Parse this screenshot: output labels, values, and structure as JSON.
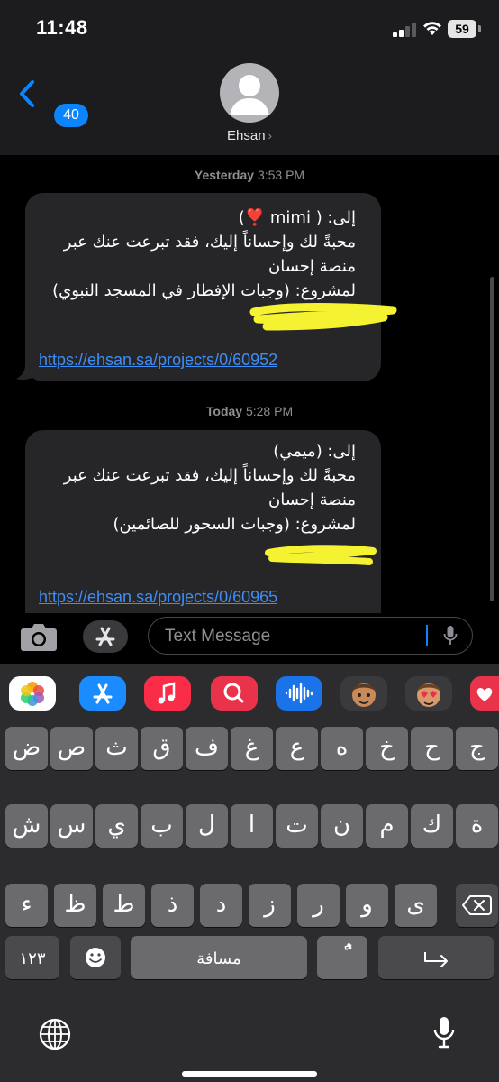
{
  "status_bar": {
    "time": "11:48",
    "battery": "59"
  },
  "header": {
    "unread_count": "40",
    "contact_name": "Ehsan",
    "contact_chevron": "›"
  },
  "messages": [
    {
      "timestamp_day": "Yesterday",
      "timestamp_time": "3:53 PM",
      "lines": [
        "إلى: ( mimi ❣️)",
        "محبةً لك وإحساناً إليك، فقد تبرعت عنك عبر",
        "منصة إحسان",
        "لمشروع: (وجبات الإفطار في المسجد النبوي)"
      ],
      "link": "https://ehsan.sa/projects/0/60952"
    },
    {
      "timestamp_day": "Today",
      "timestamp_time": "5:28 PM",
      "lines": [
        "إلى: (ميمي)",
        "محبةً لك وإحساناً إليك، فقد تبرعت عنك عبر",
        "منصة إحسان",
        "لمشروع: (وجبات السحور للصائمين)"
      ],
      "link": "https://ehsan.sa/projects/0/60965"
    }
  ],
  "input": {
    "placeholder": "Text Message"
  },
  "app_strip": [
    "photos-icon",
    "app-store-icon",
    "music-icon",
    "search-images-icon",
    "audio-message-icon",
    "memoji-icon",
    "memoji-stickers-icon",
    "digital-touch-icon"
  ],
  "keyboard": {
    "row1": [
      "ض",
      "ص",
      "ث",
      "ق",
      "ف",
      "غ",
      "ع",
      "ه",
      "خ",
      "ح",
      "ج"
    ],
    "row2": [
      "ش",
      "س",
      "ي",
      "ب",
      "ل",
      "ا",
      "ت",
      "ن",
      "م",
      "ك",
      "ة"
    ],
    "row3": [
      "ء",
      "ظ",
      "ط",
      "ذ",
      "د",
      "ز",
      "ر",
      "و",
      "ى"
    ],
    "numbers_key": "١٢٣",
    "space_key": "مسافة",
    "diacritic_key": "ًٌ"
  },
  "colors": {
    "accent": "#0a84ff",
    "bubble": "#262628",
    "link": "#3e8ef7",
    "highlight": "#f5f232"
  }
}
